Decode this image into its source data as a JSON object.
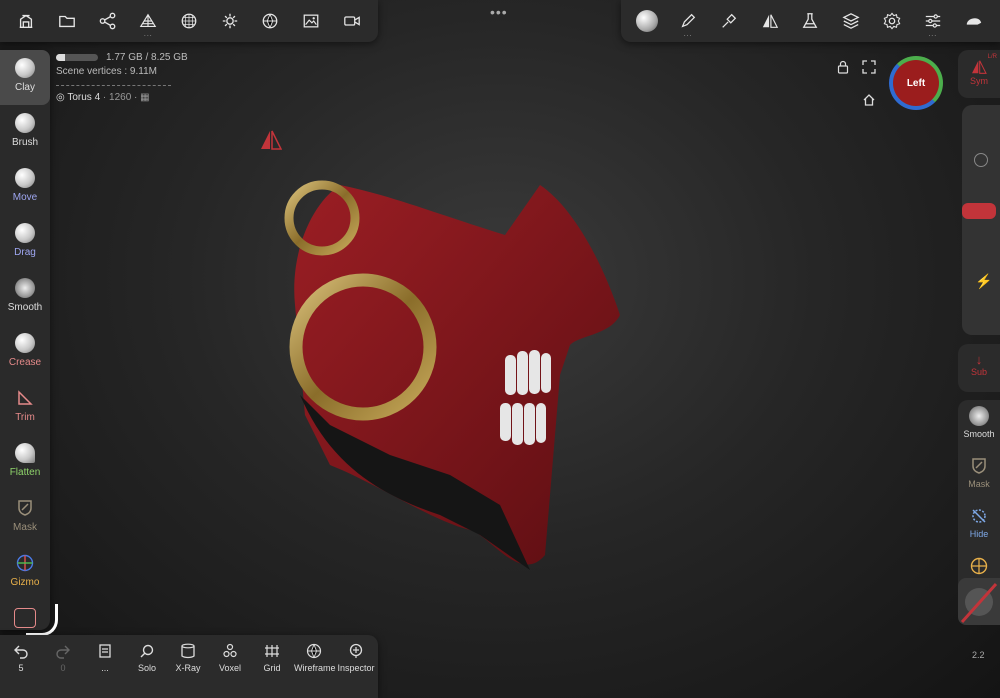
{
  "colors": {
    "accent_red": "#c2343a",
    "panel": "#2b2b2b",
    "mask_red": "#8a1a1f",
    "ring_gold": "#b99a4a"
  },
  "top_left_toolbar": {
    "buttons": [
      {
        "name": "scene-icon"
      },
      {
        "name": "folder-icon"
      },
      {
        "name": "share-icon"
      },
      {
        "name": "topology-icon",
        "sub": "..."
      },
      {
        "name": "mesh-sphere-icon"
      },
      {
        "name": "light-icon"
      },
      {
        "name": "material-icon"
      },
      {
        "name": "image-icon"
      },
      {
        "name": "camera-icon"
      }
    ]
  },
  "top_right_toolbar": {
    "buttons": [
      {
        "name": "material-ball-icon"
      },
      {
        "name": "stroke-icon",
        "sub": "..."
      },
      {
        "name": "brush-settings-icon"
      },
      {
        "name": "symmetry-icon"
      },
      {
        "name": "flask-icon"
      },
      {
        "name": "layers-icon"
      },
      {
        "name": "settings-icon"
      },
      {
        "name": "sliders-icon",
        "sub": "..."
      },
      {
        "name": "cap-icon"
      }
    ]
  },
  "info": {
    "memory": "1.77 GB / 8.25 GB",
    "memory_fraction": 0.21,
    "scene_vertices": "Scene vertices : 9.11M",
    "object_name": "Torus 4",
    "object_count": "· 1260 ·"
  },
  "left_tools": [
    {
      "label": "Clay",
      "color": "#dddddd"
    },
    {
      "label": "Brush",
      "color": "#dddddd"
    },
    {
      "label": "Move",
      "color": "#9ea6f0"
    },
    {
      "label": "Drag",
      "color": "#9ea6f0"
    },
    {
      "label": "Smooth",
      "color": "#dddddd"
    },
    {
      "label": "Crease",
      "color": "#e58a8a"
    },
    {
      "label": "Trim",
      "color": "#e58a8a"
    },
    {
      "label": "Flatten",
      "color": "#8fd46b"
    },
    {
      "label": "Mask",
      "color": "#9a8f7a"
    },
    {
      "label": "Gizmo",
      "color": "#e8b04a"
    }
  ],
  "bottom_bar": {
    "undo_count": "5",
    "redo_count": "0",
    "items": [
      {
        "label": "...",
        "name": "layers-icon"
      },
      {
        "label": "Solo",
        "name": "search-icon"
      },
      {
        "label": "X-Ray",
        "name": "xray-icon"
      },
      {
        "label": "Voxel",
        "name": "voxel-icon"
      },
      {
        "label": "Grid",
        "name": "grid-icon"
      },
      {
        "label": "Wireframe",
        "name": "wireframe-icon"
      },
      {
        "label": "Inspector",
        "name": "inspector-icon"
      }
    ]
  },
  "right_tools": {
    "sym_label": "Sym",
    "sym_sub": "L/R",
    "sub_label": "Sub",
    "smooth_label": "Smooth",
    "mask_label": "Mask",
    "hide_label": "Hide",
    "slider1_fraction": 0.5
  },
  "view_cube_label": "Left",
  "zoom_value": "2.2"
}
